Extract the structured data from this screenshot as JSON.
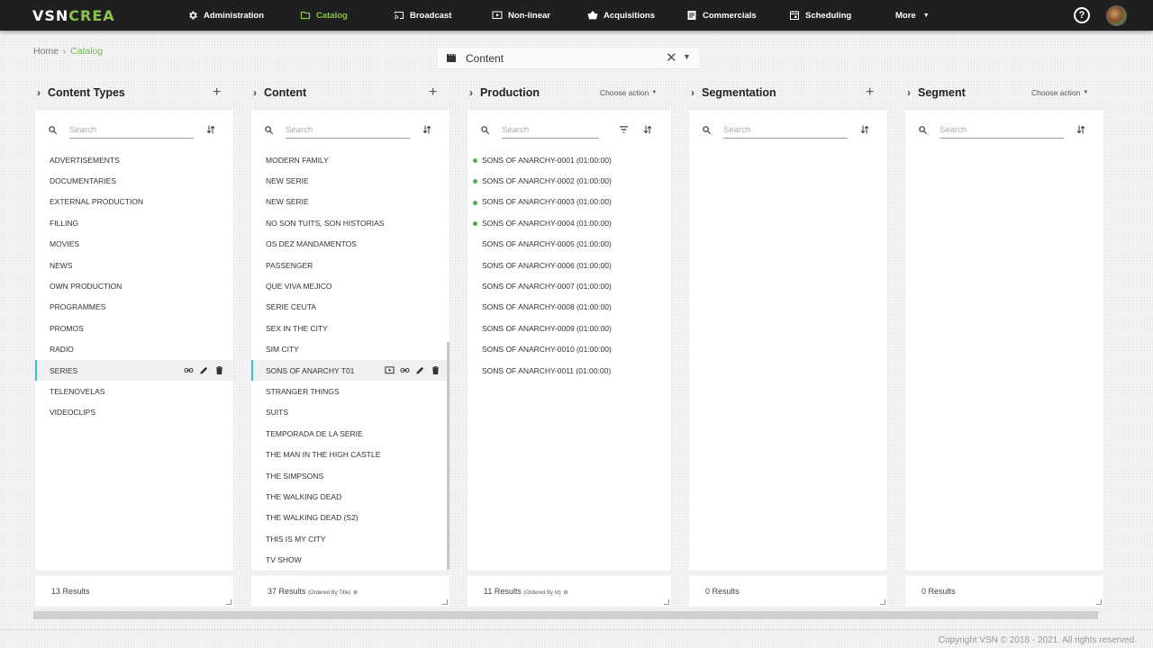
{
  "app": {
    "logo_main": "VSN",
    "logo_accent": "CREA"
  },
  "nav": {
    "administration": "Administration",
    "catalog": "Catalog",
    "broadcast": "Broadcast",
    "nonlinear": "Non-linear",
    "acquisitions": "Acquisitions",
    "commercials": "Commercials",
    "scheduling": "Scheduling",
    "more": "More",
    "help": "?"
  },
  "breadcrumb": {
    "home": "Home",
    "current": "Catalog"
  },
  "selector": {
    "value": "Content"
  },
  "columns": {
    "content_types": {
      "title": "Content Types",
      "search_placeholder": "Search",
      "items": [
        "ADVERTISEMENTS",
        "DOCUMENTARIES",
        "EXTERNAL PRODUCTION",
        "FILLING",
        "MOVIES",
        "NEWS",
        "OWN PRODUCTION",
        "PROGRAMMES",
        "PROMOS",
        "RADIO",
        "SERIES",
        "TELENOVELAS",
        "VIDEOCLIPS"
      ],
      "selected": "SERIES",
      "results": "13 Results"
    },
    "content": {
      "title": "Content",
      "search_placeholder": "Search",
      "items": [
        "MODERN FAMILY",
        "NEW SERIE",
        "NEW SERIE",
        "NO SON TUITS, SON HISTORIAS",
        "OS DEZ MANDAMENTOS",
        "PASSENGER",
        "QUE VIVA MEJICO",
        "SERIE CEUTA",
        "SEX IN THE CITY",
        "SIM CITY",
        "SONS OF ANARCHY T01",
        "STRANGER THINGS",
        "SUITS",
        "TEMPORADA DE LA SERIE",
        "THE MAN IN THE HIGH CASTLE",
        "THE SIMPSONS",
        "THE WALKING DEAD",
        "THE WALKING DEAD (S2)",
        "THIS IS MY CITY",
        "TV SHOW"
      ],
      "selected": "SONS OF ANARCHY T01",
      "results": "37 Results",
      "order": "(Ordered By Title)"
    },
    "production": {
      "title": "Production",
      "action": "Choose action",
      "search_placeholder": "Search",
      "items": [
        "SONS OF ANARCHY-0001 (01:00:00)",
        "SONS OF ANARCHY-0002 (01:00:00)",
        "SONS OF ANARCHY-0003 (01:00:00)",
        "SONS OF ANARCHY-0004 (01:00:00)",
        "SONS OF ANARCHY-0005 (01:00:00)",
        "SONS OF ANARCHY-0006 (01:00:00)",
        "SONS OF ANARCHY-0007 (01:00:00)",
        "SONS OF ANARCHY-0008 (01:00:00)",
        "SONS OF ANARCHY-0009 (01:00:00)",
        "SONS OF ANARCHY-0010 (01:00:00)",
        "SONS OF ANARCHY-0011 (01:00:00)"
      ],
      "status_dots": [
        true,
        true,
        true,
        true,
        false,
        false,
        false,
        false,
        false,
        false,
        false
      ],
      "results": "11 Results",
      "order": "(Ordered By Id)"
    },
    "segmentation": {
      "title": "Segmentation",
      "search_placeholder": "Search",
      "results": "0 Results"
    },
    "segment": {
      "title": "Segment",
      "action": "Choose action",
      "search_placeholder": "Search",
      "results": "0 Results"
    }
  },
  "colors": {
    "accent": "#8bc34a",
    "selection_bar": "#35c4c7",
    "status_dot": "#4caf50",
    "topbar": "#1f1f1f"
  },
  "footer": {
    "copyright": "Copyright VSN © 2018 - 2021. All rights reserved."
  }
}
